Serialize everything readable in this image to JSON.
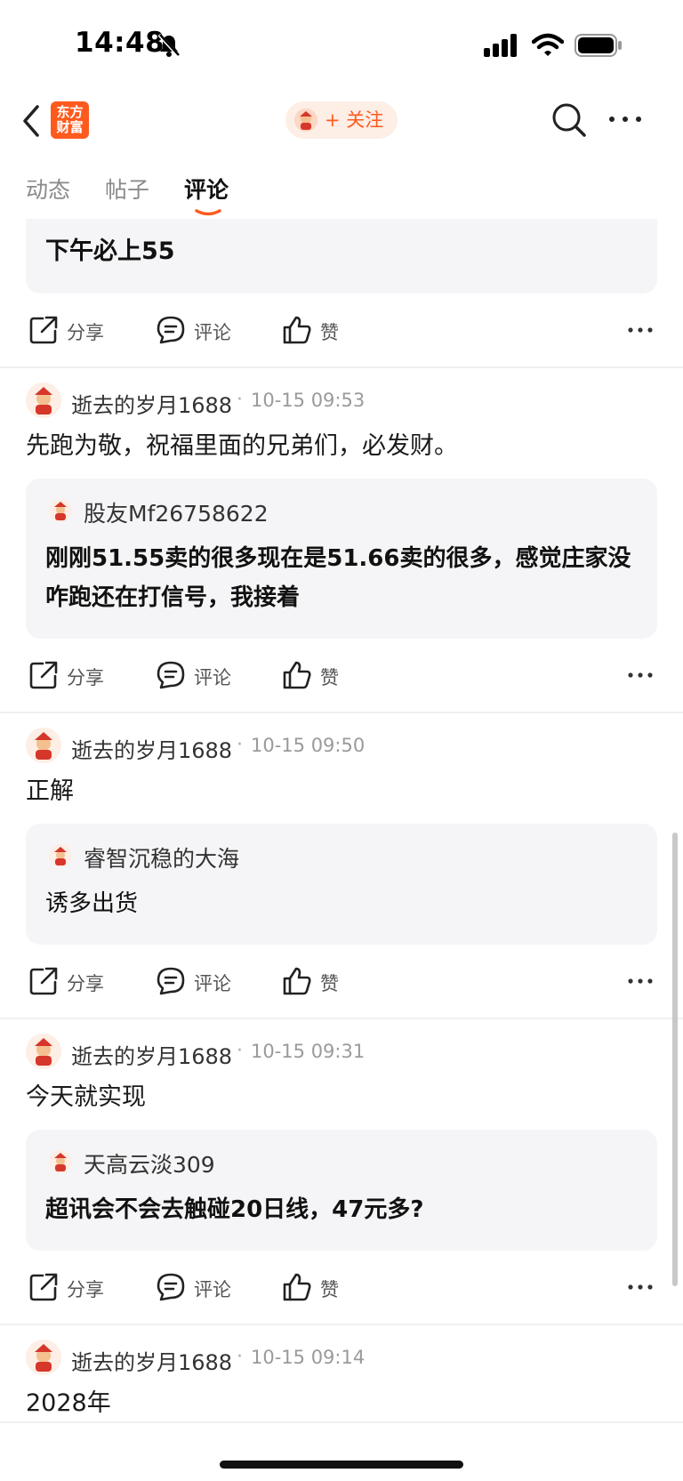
{
  "status_bar": {
    "time": "14:48"
  },
  "header": {
    "logo_line1": "东方",
    "logo_line2": "财富",
    "follow_label": "+ 关注"
  },
  "tabs": [
    {
      "label": "动态",
      "active": false
    },
    {
      "label": "帖子",
      "active": false
    },
    {
      "label": "评论",
      "active": true
    }
  ],
  "actions": {
    "share": "分享",
    "comment": "评论",
    "like": "赞"
  },
  "top_partial": {
    "quote_text": "下午必上55"
  },
  "posts": [
    {
      "author": "逝去的岁月1688",
      "time": "10-15 09:53",
      "text": "先跑为敬，祝福里面的兄弟们，必发财。",
      "quote_author": "股友Mf26758622",
      "quote_text": "刚刚51.55卖的很多现在是51.66卖的很多，感觉庄家没咋跑还在打信号，我接着"
    },
    {
      "author": "逝去的岁月1688",
      "time": "10-15 09:50",
      "text": "正解",
      "quote_author": "睿智沉稳的大海",
      "quote_text": "诱多出货"
    },
    {
      "author": "逝去的岁月1688",
      "time": "10-15 09:31",
      "text": "今天就实现",
      "quote_author": "天高云淡309",
      "quote_text": "超讯会不会去触碰20日线，47元多?"
    },
    {
      "author": "逝去的岁月1688",
      "time": "10-15 09:14",
      "text": "2028年"
    }
  ],
  "colors": {
    "brand": "#ff5a1e",
    "follow_bg": "#fdeee6",
    "quote_bg": "#f5f5f7"
  }
}
